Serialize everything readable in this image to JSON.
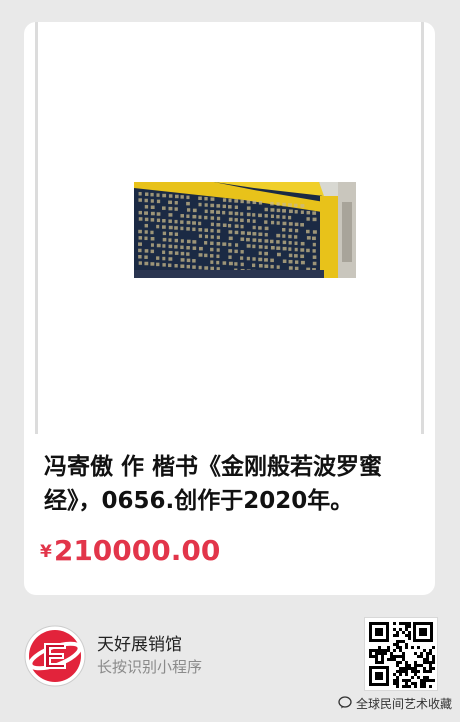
{
  "product": {
    "title": "冯寄傲 作 楷书《金刚般若波罗蜜经》，0656.创作于2020年。",
    "currency": "¥",
    "price": "210000.00"
  },
  "shop": {
    "name": "天好展销馆",
    "hint": "长按识别小程序",
    "logo_icon": "red-e-logo-icon",
    "qr_icon": "qr-code-icon"
  },
  "watermark": {
    "text": "全球民间艺术收藏",
    "icon": "chat-bubble-icon"
  },
  "colors": {
    "price": "#e2354a",
    "background": "#e9e9e9",
    "card": "#ffffff",
    "artwork_navy": "#1b2a44",
    "artwork_gold": "#e8c21a"
  }
}
